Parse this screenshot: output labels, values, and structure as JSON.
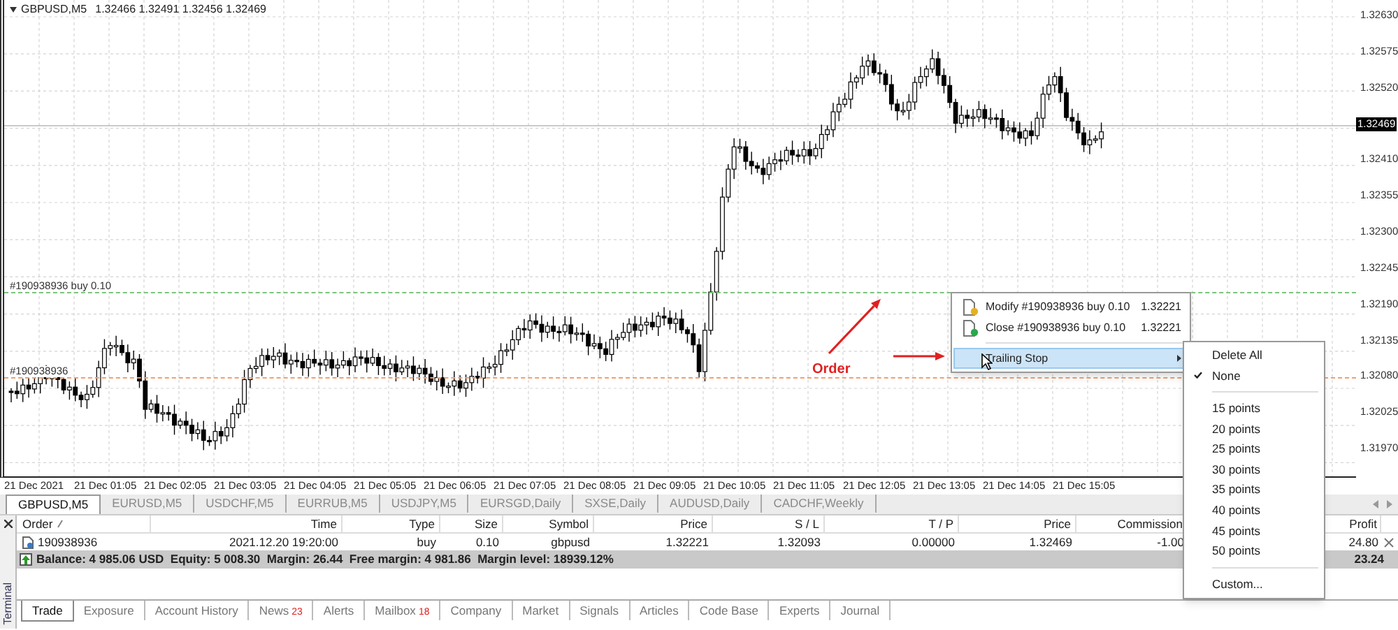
{
  "chart": {
    "symbol": "GBPUSD,M5",
    "ohlc": "1.32466 1.32491 1.32456 1.32469",
    "order_lines": [
      {
        "label": "#190938936 buy 0.10",
        "color": "#7cc47c"
      },
      {
        "label": "#190938936",
        "color": "#f0a070"
      }
    ],
    "annotation": "Order",
    "price_axis": [
      {
        "label": "1.32630",
        "current": false
      },
      {
        "label": "1.32575",
        "current": false
      },
      {
        "label": "1.32520",
        "current": false
      },
      {
        "label": "1.32469",
        "current": true
      },
      {
        "label": "1.32410",
        "current": false
      },
      {
        "label": "1.32355",
        "current": false
      },
      {
        "label": "1.32300",
        "current": false
      },
      {
        "label": "1.32245",
        "current": false
      },
      {
        "label": "1.32190",
        "current": false
      },
      {
        "label": "1.32135",
        "current": false
      },
      {
        "label": "1.32080",
        "current": false
      },
      {
        "label": "1.32025",
        "current": false
      },
      {
        "label": "1.31970",
        "current": false
      }
    ],
    "time_axis": [
      "21 Dec 2021",
      "21 Dec 01:05",
      "21 Dec 02:05",
      "21 Dec 03:05",
      "21 Dec 04:05",
      "21 Dec 05:05",
      "21 Dec 06:05",
      "21 Dec 07:05",
      "21 Dec 08:05",
      "21 Dec 09:05",
      "21 Dec 10:05",
      "21 Dec 11:05",
      "21 Dec 12:05",
      "21 Dec 13:05",
      "21 Dec 14:05",
      "21 Dec 15:05"
    ]
  },
  "chart_tabs": [
    {
      "label": "GBPUSD,M5",
      "selected": true
    },
    {
      "label": "EURUSD,M5",
      "selected": false
    },
    {
      "label": "USDCHF,M5",
      "selected": false
    },
    {
      "label": "EURRUB,M5",
      "selected": false
    },
    {
      "label": "USDJPY,M5",
      "selected": false
    },
    {
      "label": "EURSGD,Daily",
      "selected": false
    },
    {
      "label": "SXSE,Daily",
      "selected": false
    },
    {
      "label": "AUDUSD,Daily",
      "selected": false
    },
    {
      "label": "CADCHF,Weekly",
      "selected": false
    }
  ],
  "context_menu": {
    "items": [
      {
        "kind": "modify",
        "label": "Modify #190938936 buy 0.10",
        "value": "1.32221",
        "highlighted": false
      },
      {
        "kind": "close",
        "label": "Close #190938936 buy 0.10",
        "value": "1.32221",
        "highlighted": false
      },
      {
        "kind": "submenu",
        "label": "Trailing Stop",
        "highlighted": true
      }
    ]
  },
  "submenu": {
    "groups": [
      {
        "items": [
          {
            "label": "Delete All",
            "checked": false
          },
          {
            "label": "None",
            "checked": true
          }
        ]
      },
      {
        "items": [
          {
            "label": "15 points",
            "checked": false
          },
          {
            "label": "20 points",
            "checked": false
          },
          {
            "label": "25 points",
            "checked": false
          },
          {
            "label": "30 points",
            "checked": false
          },
          {
            "label": "35 points",
            "checked": false
          },
          {
            "label": "40 points",
            "checked": false
          },
          {
            "label": "45 points",
            "checked": false
          },
          {
            "label": "50 points",
            "checked": false
          }
        ]
      },
      {
        "items": [
          {
            "label": "Custom...",
            "checked": false
          }
        ]
      }
    ]
  },
  "terminal": {
    "title": "Terminal",
    "columns": [
      "Order",
      "Time",
      "Type",
      "Size",
      "Symbol",
      "Price",
      "S / L",
      "T / P",
      "Price",
      "Commission",
      "Profit"
    ],
    "rows": [
      {
        "cells": [
          "190938936",
          "2021.12.20 19:20:00",
          "buy",
          "0.10",
          "gbpusd",
          "1.32221",
          "1.32093",
          "0.00000",
          "1.32469",
          "-1.00",
          "24.80"
        ]
      }
    ],
    "summary": {
      "text": "Balance: 4 985.06 USD  Equity: 5 008.30  Margin: 26.44  Free margin: 4 981.86  Margin level: 18939.12%",
      "profit": "23.24"
    },
    "tabs": [
      {
        "label": "Trade",
        "selected": true
      },
      {
        "label": "Exposure",
        "selected": false
      },
      {
        "label": "Account History",
        "selected": false
      },
      {
        "label": "News",
        "badge": "23",
        "selected": false
      },
      {
        "label": "Alerts",
        "selected": false
      },
      {
        "label": "Mailbox",
        "badge": "18",
        "selected": false
      },
      {
        "label": "Company",
        "selected": false
      },
      {
        "label": "Market",
        "selected": false
      },
      {
        "label": "Signals",
        "selected": false
      },
      {
        "label": "Articles",
        "selected": false
      },
      {
        "label": "Code Base",
        "selected": false
      },
      {
        "label": "Experts",
        "selected": false
      },
      {
        "label": "Journal",
        "selected": false
      }
    ]
  }
}
